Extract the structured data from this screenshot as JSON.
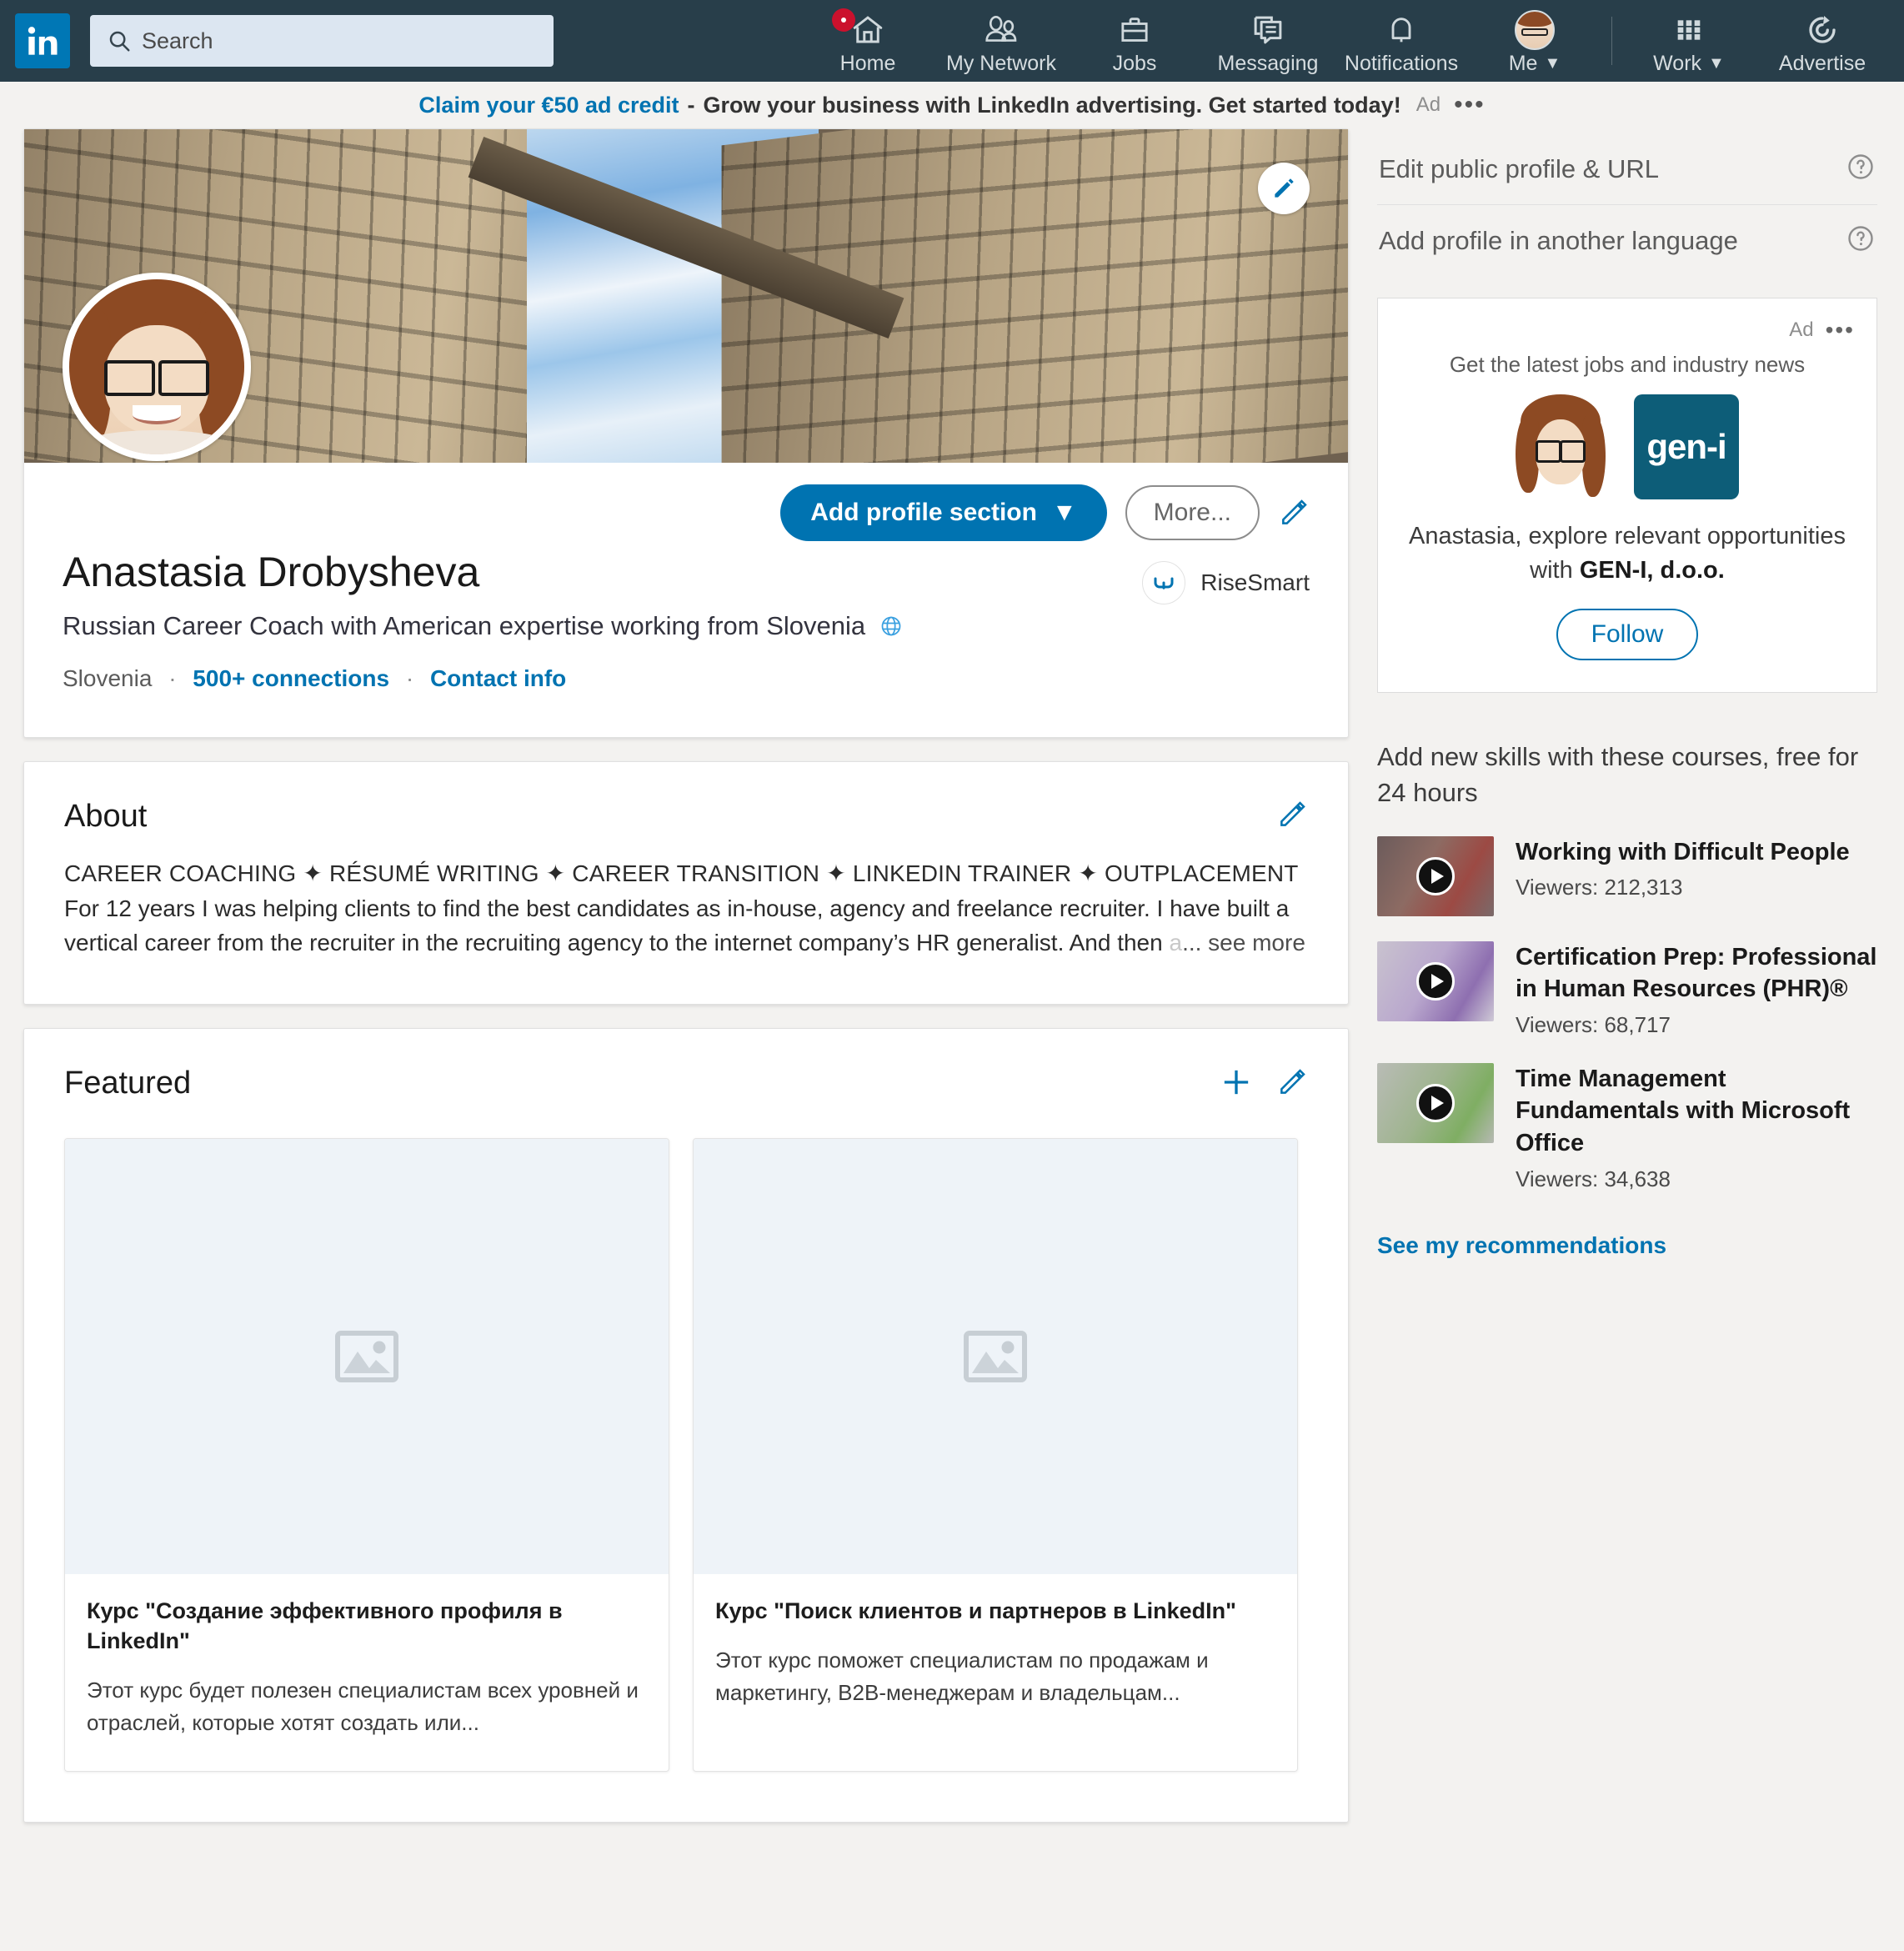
{
  "nav": {
    "logo_icon": "linkedin-logo-icon",
    "search_placeholder": "Search",
    "items": [
      {
        "label": "Home",
        "icon": "home-icon",
        "badge": true
      },
      {
        "label": "My Network",
        "icon": "people-icon",
        "badge": false
      },
      {
        "label": "Jobs",
        "icon": "briefcase-icon",
        "badge": false
      },
      {
        "label": "Messaging",
        "icon": "message-icon",
        "badge": false
      },
      {
        "label": "Notifications",
        "icon": "bell-icon",
        "badge": false
      },
      {
        "label": "Me",
        "icon": "avatar-icon",
        "badge": false,
        "caret": true
      }
    ],
    "right_items": [
      {
        "label": "Work",
        "icon": "grid-icon",
        "caret": true
      },
      {
        "label": "Advertise",
        "icon": "advertise-icon",
        "caret": false
      }
    ]
  },
  "ad_banner": {
    "link_text": "Claim your €50 ad credit",
    "dash": "-",
    "body_text": "Grow your business with LinkedIn advertising. Get started today!",
    "tag": "Ad",
    "menu_dots": "•••"
  },
  "profile": {
    "cover_edit_icon": "pencil-icon",
    "avatar_icon": "profile-photo",
    "name": "Anastasia Drobysheva",
    "headline": "Russian Career Coach with American expertise working from Slovenia",
    "headline_globe_icon": "globe-icon",
    "location": "Slovenia",
    "connections": "500+ connections",
    "contact_info": "Contact info",
    "separator": "·",
    "company": "RiseSmart",
    "company_logo_icon": "risesmart-logo-icon",
    "actions": {
      "add_section_label": "Add profile section",
      "add_section_caret": "▼",
      "more_label": "More...",
      "edit_icon": "pencil-icon"
    }
  },
  "about": {
    "title": "About",
    "edit_icon": "pencil-icon",
    "line1": "CAREER COACHING ✦ RÉSUMÉ WRITING ✦ CAREER TRANSITION ✦ LINKEDIN TRAINER ✦ OUTPLACEMENT",
    "line2": "For 12 years I was helping clients to find the best candidates as in-house, agency and freelance recruiter. I have built a vertical career from the recruiter in the recruiting agency to the internet company’s HR generalist. And then ",
    "faded": "a",
    "see_more": "... see more"
  },
  "featured": {
    "title": "Featured",
    "add_icon": "plus-icon",
    "edit_icon": "pencil-icon",
    "items": [
      {
        "thumb_icon": "image-placeholder-icon",
        "title": "Курс \"Создание эффективного профиля в LinkedIn\"",
        "description": "Этот курс будет полезен специалистам всех уровней и отраслей, которые хотят создать или..."
      },
      {
        "thumb_icon": "image-placeholder-icon",
        "title": "Курс \"Поиск клиентов и партнеров в LinkedIn\"",
        "description": "Этот курс поможет специалистам по продажам и маркетингу, B2B-менеджерам и владельцам..."
      }
    ]
  },
  "sidebar": {
    "links": [
      {
        "label": "Edit public profile & URL",
        "help_icon": "help-circle-icon"
      },
      {
        "label": "Add profile in another language",
        "help_icon": "help-circle-icon"
      }
    ],
    "ad_card": {
      "tag": "Ad",
      "menu_dots": "•••",
      "tagline": "Get the latest jobs and industry news",
      "person_icon": "profile-photo",
      "brand_logo_text": "gen-i",
      "copy_prefix": "Anastasia, explore relevant opportunities with ",
      "copy_bold": "GEN-I, d.o.o.",
      "follow_label": "Follow"
    },
    "courses": {
      "title": "Add new skills with these courses, free for 24 hours",
      "items": [
        {
          "name": "Working with Difficult People",
          "viewers": "Viewers: 212,313",
          "play_icon": "play-icon"
        },
        {
          "name": "Certification Prep: Professional in Human Resources (PHR)®",
          "viewers": "Viewers: 68,717",
          "play_icon": "play-icon"
        },
        {
          "name": "Time Management Fundamentals with Microsoft Office",
          "viewers": "Viewers: 34,638",
          "play_icon": "play-icon"
        }
      ],
      "see_recommendations": "See my recommendations"
    }
  },
  "colors": {
    "nav_bg": "#283e4a",
    "brand_blue": "#0073b1",
    "page_bg": "#f3f2f0",
    "badge_red": "#cb112d",
    "geni_teal": "#0d5d78"
  }
}
